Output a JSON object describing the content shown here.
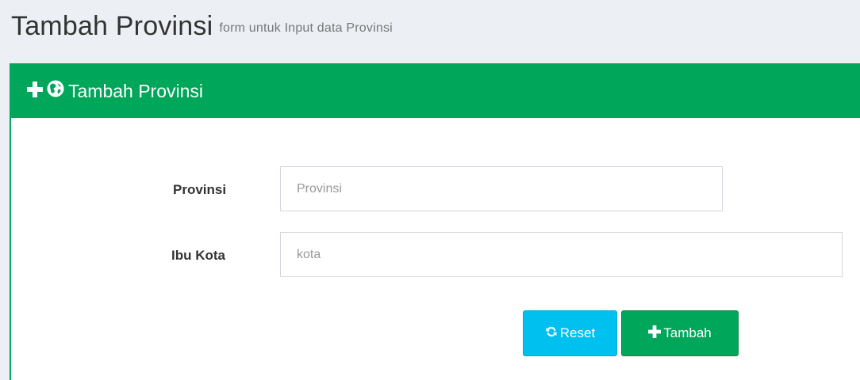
{
  "header": {
    "title": "Tambah Provinsi",
    "subtitle": "form untuk Input data Provinsi"
  },
  "box": {
    "title": "Tambah Provinsi",
    "icons": [
      "plus-icon",
      "globe-icon"
    ],
    "accent_color": "#00a65a"
  },
  "form": {
    "provinsi": {
      "label": "Provinsi",
      "value": "",
      "placeholder": "Provinsi"
    },
    "ibu_kota": {
      "label": "Ibu Kota",
      "value": "",
      "placeholder": "kota"
    }
  },
  "buttons": {
    "reset": {
      "label": "Reset",
      "icon": "refresh-icon",
      "color": "#00c0ef"
    },
    "tambah": {
      "label": "Tambah",
      "icon": "plus-icon",
      "color": "#00a65a"
    }
  }
}
